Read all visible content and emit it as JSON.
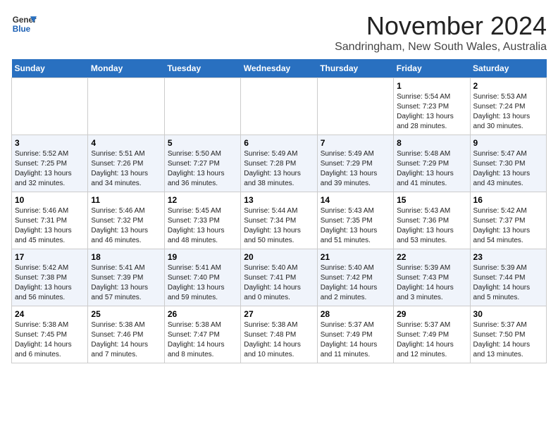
{
  "logo": {
    "line1": "General",
    "line2": "Blue"
  },
  "title": "November 2024",
  "subtitle": "Sandringham, New South Wales, Australia",
  "weekdays": [
    "Sunday",
    "Monday",
    "Tuesday",
    "Wednesday",
    "Thursday",
    "Friday",
    "Saturday"
  ],
  "weeks": [
    [
      {
        "day": "",
        "info": ""
      },
      {
        "day": "",
        "info": ""
      },
      {
        "day": "",
        "info": ""
      },
      {
        "day": "",
        "info": ""
      },
      {
        "day": "",
        "info": ""
      },
      {
        "day": "1",
        "info": "Sunrise: 5:54 AM\nSunset: 7:23 PM\nDaylight: 13 hours and 28 minutes."
      },
      {
        "day": "2",
        "info": "Sunrise: 5:53 AM\nSunset: 7:24 PM\nDaylight: 13 hours and 30 minutes."
      }
    ],
    [
      {
        "day": "3",
        "info": "Sunrise: 5:52 AM\nSunset: 7:25 PM\nDaylight: 13 hours and 32 minutes."
      },
      {
        "day": "4",
        "info": "Sunrise: 5:51 AM\nSunset: 7:26 PM\nDaylight: 13 hours and 34 minutes."
      },
      {
        "day": "5",
        "info": "Sunrise: 5:50 AM\nSunset: 7:27 PM\nDaylight: 13 hours and 36 minutes."
      },
      {
        "day": "6",
        "info": "Sunrise: 5:49 AM\nSunset: 7:28 PM\nDaylight: 13 hours and 38 minutes."
      },
      {
        "day": "7",
        "info": "Sunrise: 5:49 AM\nSunset: 7:29 PM\nDaylight: 13 hours and 39 minutes."
      },
      {
        "day": "8",
        "info": "Sunrise: 5:48 AM\nSunset: 7:29 PM\nDaylight: 13 hours and 41 minutes."
      },
      {
        "day": "9",
        "info": "Sunrise: 5:47 AM\nSunset: 7:30 PM\nDaylight: 13 hours and 43 minutes."
      }
    ],
    [
      {
        "day": "10",
        "info": "Sunrise: 5:46 AM\nSunset: 7:31 PM\nDaylight: 13 hours and 45 minutes."
      },
      {
        "day": "11",
        "info": "Sunrise: 5:46 AM\nSunset: 7:32 PM\nDaylight: 13 hours and 46 minutes."
      },
      {
        "day": "12",
        "info": "Sunrise: 5:45 AM\nSunset: 7:33 PM\nDaylight: 13 hours and 48 minutes."
      },
      {
        "day": "13",
        "info": "Sunrise: 5:44 AM\nSunset: 7:34 PM\nDaylight: 13 hours and 50 minutes."
      },
      {
        "day": "14",
        "info": "Sunrise: 5:43 AM\nSunset: 7:35 PM\nDaylight: 13 hours and 51 minutes."
      },
      {
        "day": "15",
        "info": "Sunrise: 5:43 AM\nSunset: 7:36 PM\nDaylight: 13 hours and 53 minutes."
      },
      {
        "day": "16",
        "info": "Sunrise: 5:42 AM\nSunset: 7:37 PM\nDaylight: 13 hours and 54 minutes."
      }
    ],
    [
      {
        "day": "17",
        "info": "Sunrise: 5:42 AM\nSunset: 7:38 PM\nDaylight: 13 hours and 56 minutes."
      },
      {
        "day": "18",
        "info": "Sunrise: 5:41 AM\nSunset: 7:39 PM\nDaylight: 13 hours and 57 minutes."
      },
      {
        "day": "19",
        "info": "Sunrise: 5:41 AM\nSunset: 7:40 PM\nDaylight: 13 hours and 59 minutes."
      },
      {
        "day": "20",
        "info": "Sunrise: 5:40 AM\nSunset: 7:41 PM\nDaylight: 14 hours and 0 minutes."
      },
      {
        "day": "21",
        "info": "Sunrise: 5:40 AM\nSunset: 7:42 PM\nDaylight: 14 hours and 2 minutes."
      },
      {
        "day": "22",
        "info": "Sunrise: 5:39 AM\nSunset: 7:43 PM\nDaylight: 14 hours and 3 minutes."
      },
      {
        "day": "23",
        "info": "Sunrise: 5:39 AM\nSunset: 7:44 PM\nDaylight: 14 hours and 5 minutes."
      }
    ],
    [
      {
        "day": "24",
        "info": "Sunrise: 5:38 AM\nSunset: 7:45 PM\nDaylight: 14 hours and 6 minutes."
      },
      {
        "day": "25",
        "info": "Sunrise: 5:38 AM\nSunset: 7:46 PM\nDaylight: 14 hours and 7 minutes."
      },
      {
        "day": "26",
        "info": "Sunrise: 5:38 AM\nSunset: 7:47 PM\nDaylight: 14 hours and 8 minutes."
      },
      {
        "day": "27",
        "info": "Sunrise: 5:38 AM\nSunset: 7:48 PM\nDaylight: 14 hours and 10 minutes."
      },
      {
        "day": "28",
        "info": "Sunrise: 5:37 AM\nSunset: 7:49 PM\nDaylight: 14 hours and 11 minutes."
      },
      {
        "day": "29",
        "info": "Sunrise: 5:37 AM\nSunset: 7:49 PM\nDaylight: 14 hours and 12 minutes."
      },
      {
        "day": "30",
        "info": "Sunrise: 5:37 AM\nSunset: 7:50 PM\nDaylight: 14 hours and 13 minutes."
      }
    ]
  ]
}
